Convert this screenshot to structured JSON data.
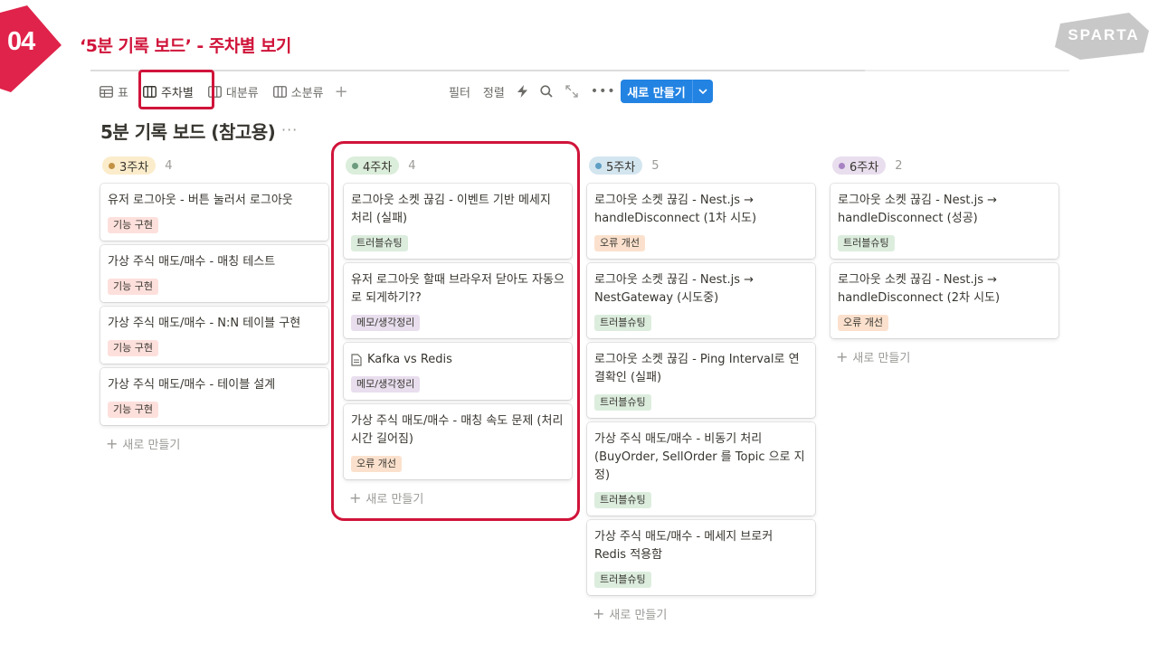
{
  "slide": {
    "number": "04",
    "title": "‘5분 기록 보드’ - 주차별 보기",
    "brand": "SPARTA",
    "colors": {
      "accent": "#d0143a",
      "brand_bg": "#c8c8c8"
    }
  },
  "views": [
    {
      "label": "표",
      "icon": "table-icon"
    },
    {
      "label": "주차별",
      "icon": "board-icon",
      "active": true
    },
    {
      "label": "대분류",
      "icon": "board-icon"
    },
    {
      "label": "소분류",
      "icon": "board-icon"
    }
  ],
  "toolbar": {
    "filter": "필터",
    "sort": "정렬",
    "new_button": "새로 만들기"
  },
  "board": {
    "title": "5분 기록 보드 (참고용)",
    "more": "···",
    "add_label": "새로 만들기"
  },
  "tag_colors": {
    "기능 구현": "#fde0dc",
    "트러블슈팅": "#dcedde",
    "메모/생각정리": "#e8deee",
    "오류 개선": "#fbe1cd"
  },
  "columns": [
    {
      "label": "3주차",
      "count": "4",
      "pill_bg": "#fbeccb",
      "dot": "#c29243",
      "cards": [
        {
          "title": "유저 로그아웃 - 버튼 눌러서 로그아웃",
          "tag": "기능 구현"
        },
        {
          "title": "가상 주식 매도/매수 - 매칭 테스트",
          "tag": "기능 구현"
        },
        {
          "title": "가상 주식 매도/매수 - N:N 테이블 구현",
          "tag": "기능 구현"
        },
        {
          "title": "가상 주식 매도/매수 - 테이블 설계",
          "tag": "기능 구현"
        }
      ]
    },
    {
      "label": "4주차",
      "count": "4",
      "pill_bg": "#dbeddb",
      "dot": "#6c9b7d",
      "cards": [
        {
          "title": "로그아웃 소켓 끊김 - 이벤트 기반 메세지 처리 (실패)",
          "tag": "트러블슈팅"
        },
        {
          "title": "유저 로그아웃 할때 브라우저 닫아도 자동으로 되게하기??",
          "tag": "메모/생각정리"
        },
        {
          "title": "Kafka vs Redis",
          "tag": "메모/생각정리",
          "icon": "page-icon"
        },
        {
          "title": "가상 주식 매도/매수 - 매칭 속도 문제 (처리 시간 길어짐)",
          "tag": "오류 개선"
        }
      ]
    },
    {
      "label": "5주차",
      "count": "5",
      "pill_bg": "#d3e5ef",
      "dot": "#5e9fc4",
      "cards": [
        {
          "title": "로그아웃 소켓 끊김 - Nest.js → handleDisconnect (1차 시도)",
          "tag": "오류 개선"
        },
        {
          "title": "로그아웃 소켓 끊김 - Nest.js → NestGateway (시도중)",
          "tag": "트러블슈팅"
        },
        {
          "title": "로그아웃 소켓 끊김 - Ping Interval로 연결확인 (실패)",
          "tag": "트러블슈팅"
        },
        {
          "title": "가상 주식 매도/매수 - 비동기 처리 (BuyOrder, SellOrder 를 Topic 으로 지정)",
          "tag": "트러블슈팅"
        },
        {
          "title": "가상 주식 매도/매수 - 메세지 브로커 Redis 적용함",
          "tag": "트러블슈팅"
        }
      ]
    },
    {
      "label": "6주차",
      "count": "2",
      "pill_bg": "#e8deee",
      "dot": "#a782c3",
      "cards": [
        {
          "title": "로그아웃 소켓 끊김 - Nest.js → handleDisconnect (성공)",
          "tag": "트러블슈팅"
        },
        {
          "title": "로그아웃 소켓 끊김 - Nest.js → handleDisconnect (2차 시도)",
          "tag": "오류 개선"
        }
      ]
    }
  ]
}
